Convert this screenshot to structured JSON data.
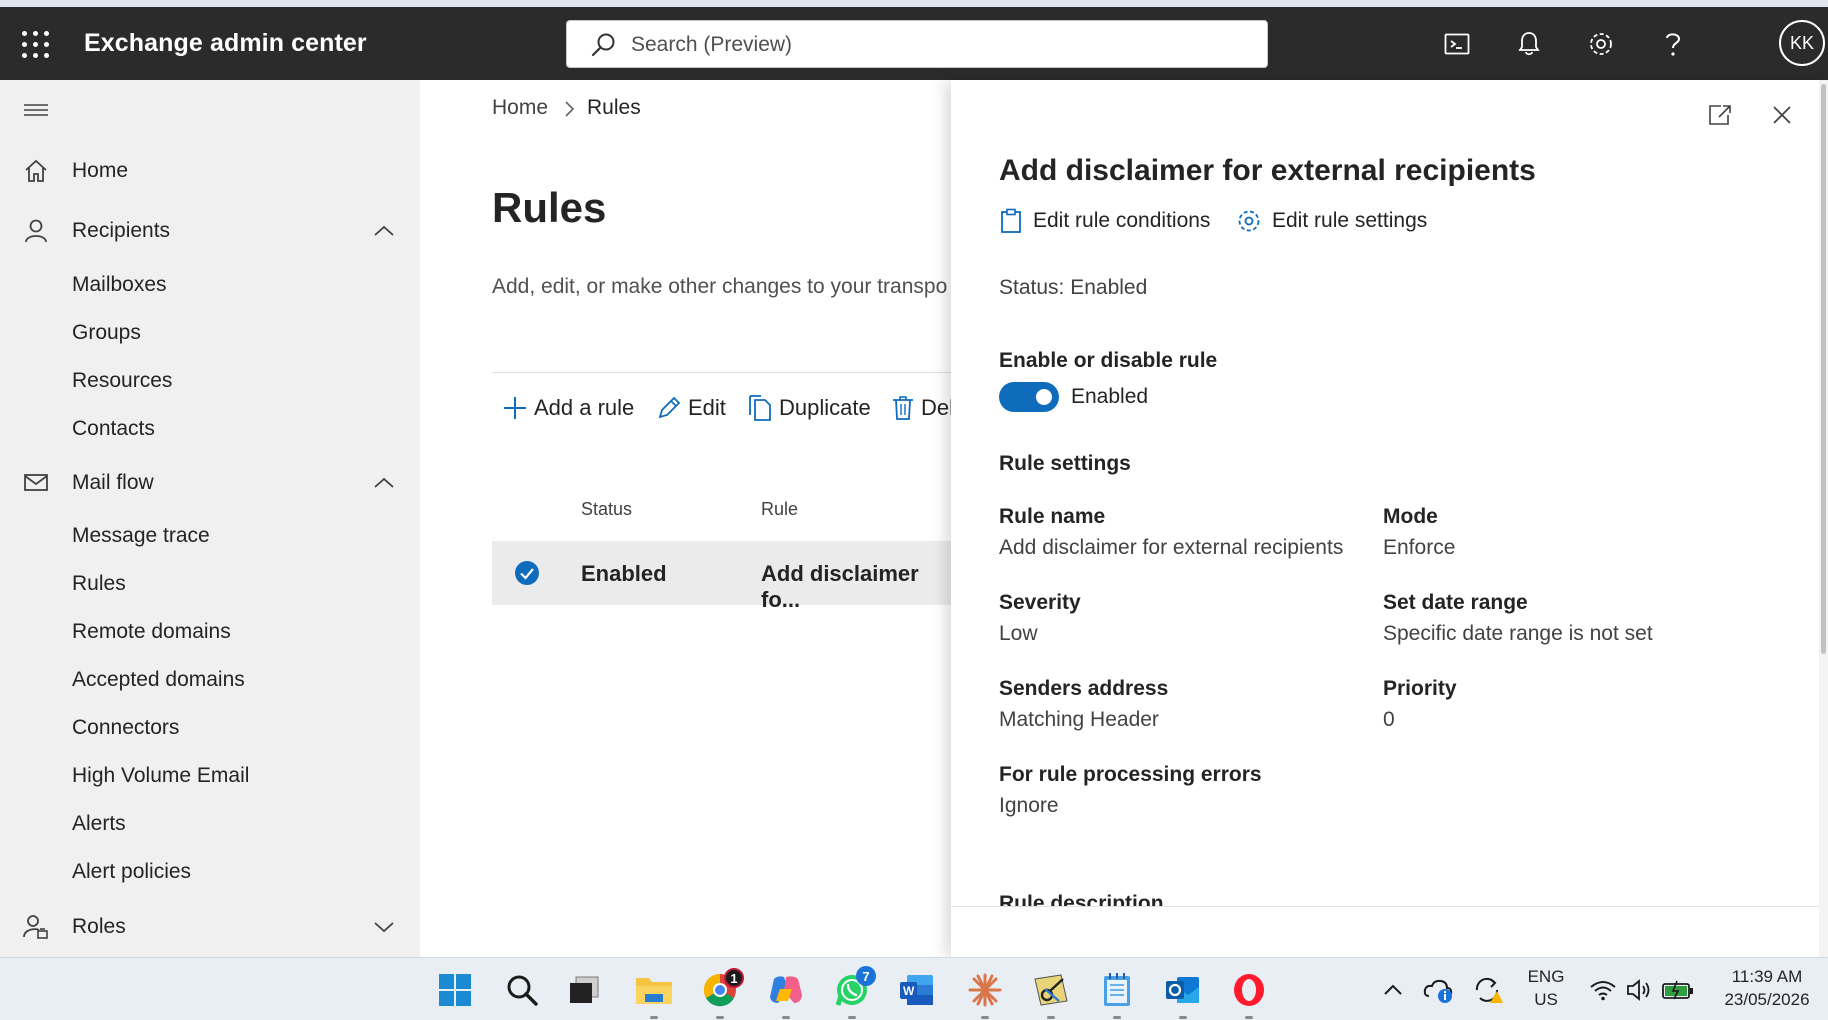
{
  "app": {
    "title": "Exchange admin center",
    "search_placeholder": "Search (Preview)",
    "user_initials": "KK"
  },
  "nav": {
    "home": "Home",
    "recipients": "Recipients",
    "recipients_items": [
      "Mailboxes",
      "Groups",
      "Resources",
      "Contacts"
    ],
    "mail_flow": "Mail flow",
    "mail_flow_items": [
      "Message trace",
      "Rules",
      "Remote domains",
      "Accepted domains",
      "Connectors",
      "High Volume Email",
      "Alerts",
      "Alert policies"
    ],
    "roles": "Roles"
  },
  "main": {
    "breadcrumb": [
      "Home",
      "Rules"
    ],
    "title": "Rules",
    "description": "Add, edit, or make other changes to your transpo",
    "commands": {
      "add": "Add a rule",
      "edit": "Edit",
      "duplicate": "Duplicate",
      "delete": "Del"
    },
    "columns": {
      "status": "Status",
      "rule": "Rule"
    },
    "rows": [
      {
        "status": "Enabled",
        "rule": "Add disclaimer fo...",
        "selected": true
      }
    ]
  },
  "panel": {
    "title": "Add disclaimer for external recipients",
    "edit_conditions": "Edit rule conditions",
    "edit_settings": "Edit rule settings",
    "status": "Status: Enabled",
    "enable_heading": "Enable or disable rule",
    "toggle_label": "Enabled",
    "toggle_on": true,
    "settings_heading": "Rule settings",
    "fields": {
      "rule_name_label": "Rule name",
      "rule_name_value": "Add disclaimer for external recipients",
      "mode_label": "Mode",
      "mode_value": "Enforce",
      "severity_label": "Severity",
      "severity_value": "Low",
      "date_range_label": "Set date range",
      "date_range_value": "Specific date range is not set",
      "senders_label": "Senders address",
      "senders_value": "Matching Header",
      "priority_label": "Priority",
      "priority_value": "0",
      "errors_label": "For rule processing errors",
      "errors_value": "Ignore"
    },
    "description_heading": "Rule description"
  },
  "taskbar": {
    "chrome_badge": "1",
    "whatsapp_badge": "7",
    "lang": "ENG",
    "region": "US",
    "time": "11:39 AM",
    "date": "23/05/2026"
  },
  "colors": {
    "topbar": "#2b2b2b",
    "accent": "#0f6cbd",
    "nav_bg": "#f0f0f0"
  }
}
